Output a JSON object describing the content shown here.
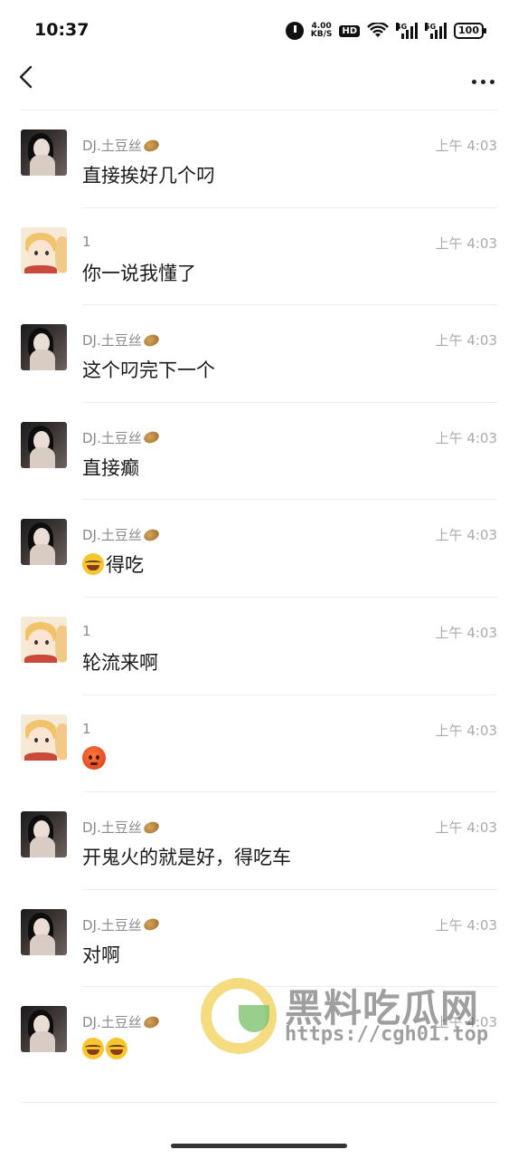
{
  "status_bar": {
    "time": "10:37",
    "net_speed_value": "4.00",
    "net_speed_unit": "KB/S",
    "hd_label": "HD",
    "sim1_label": "4G",
    "sim2_label": "5G",
    "battery": "100"
  },
  "header": {
    "back_icon": "chevron-left-icon",
    "more_icon": "more-horizontal-icon"
  },
  "messages": [
    {
      "name": "DJ.土豆丝",
      "badge": "potato-emoji",
      "time": "上午 4:03",
      "text": "直接挨好几个叼",
      "avatar": "girl"
    },
    {
      "name": "1",
      "time": "上午 4:03",
      "text": "你一说我懂了",
      "avatar": "boy"
    },
    {
      "name": "DJ.土豆丝",
      "badge": "potato-emoji",
      "time": "上午 4:03",
      "text": "这个叼完下一个",
      "avatar": "girl"
    },
    {
      "name": "DJ.土豆丝",
      "badge": "potato-emoji",
      "time": "上午 4:03",
      "text": "直接癫",
      "avatar": "girl"
    },
    {
      "name": "DJ.土豆丝",
      "badge": "potato-emoji",
      "time": "上午 4:03",
      "text": "得吃",
      "emoji": "laughing-tears-emoji",
      "avatar": "girl"
    },
    {
      "name": "1",
      "time": "上午 4:03",
      "text": "轮流来啊",
      "avatar": "boy"
    },
    {
      "name": "1",
      "time": "上午 4:03",
      "text": "",
      "emoji": "angry-face-emoji",
      "avatar": "boy"
    },
    {
      "name": "DJ.土豆丝",
      "badge": "potato-emoji",
      "time": "上午 4:03",
      "text": "开鬼火的就是好，得吃车",
      "avatar": "girl"
    },
    {
      "name": "DJ.土豆丝",
      "badge": "potato-emoji",
      "time": "上午 4:03",
      "text": "对啊",
      "avatar": "girl"
    },
    {
      "name": "DJ.土豆丝",
      "badge": "potato-emoji",
      "time": "上午 4:03",
      "text": "",
      "emoji": "laughing-tears-emoji-x2",
      "avatar": "girl"
    }
  ],
  "watermark": {
    "title": "黑料吃瓜网",
    "url": "https://cgh01.top"
  }
}
